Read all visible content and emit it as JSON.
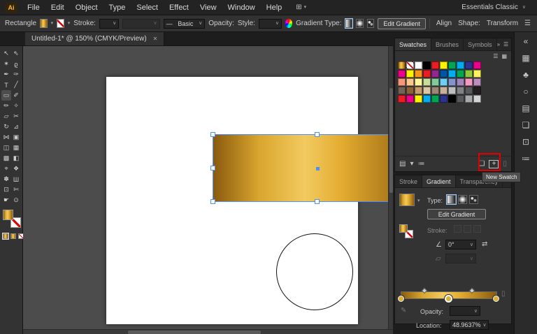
{
  "app": {
    "logo": "Ai"
  },
  "icons": {
    "caret": "∨",
    "caret_small": "▾",
    "menu": "☰",
    "close": "✕",
    "collapse_right": "»",
    "list_view": "☰",
    "grid_view": "▦",
    "arrange_docs": "⊞",
    "libraries": "▤",
    "kinds_filter": "▾",
    "options": "≔",
    "new_color_group": "❏",
    "plus": "+",
    "trash": "▯",
    "angle": "∠",
    "aspect": "▱",
    "reverse": "⇄",
    "edit_stop": "✎",
    "brush_stroke": "—",
    "hamburger": "☰"
  },
  "menubar": {
    "items": [
      "File",
      "Edit",
      "Object",
      "Type",
      "Select",
      "Effect",
      "View",
      "Window",
      "Help"
    ],
    "workspace": "Essentials Classic"
  },
  "controlbar": {
    "tool": "Rectangle",
    "stroke_label": "Stroke:",
    "brush_name": "Basic",
    "opacity_label": "Opacity:",
    "style_label": "Style:",
    "gradient_type_label": "Gradient Type:",
    "edit_gradient": "Edit Gradient",
    "align": "Align",
    "shape_label": "Shape:",
    "transform": "Transform"
  },
  "doc_tab": {
    "title": "Untitled-1* @ 150% (CMYK/Preview)"
  },
  "toolbar": {
    "active": "rectangle",
    "tools": [
      {
        "name": "selection",
        "glyph": "↖"
      },
      {
        "name": "direct-selection",
        "glyph": "⇖"
      },
      {
        "name": "magic-wand",
        "glyph": "✶"
      },
      {
        "name": "lasso",
        "glyph": "ϱ"
      },
      {
        "name": "pen",
        "glyph": "✒"
      },
      {
        "name": "curvature",
        "glyph": "✑"
      },
      {
        "name": "type",
        "glyph": "T"
      },
      {
        "name": "line-segment",
        "glyph": "╱"
      },
      {
        "name": "rectangle",
        "glyph": "▭"
      },
      {
        "name": "paintbrush",
        "glyph": "✐"
      },
      {
        "name": "pencil",
        "glyph": "✏"
      },
      {
        "name": "shaper",
        "glyph": "✧"
      },
      {
        "name": "eraser",
        "glyph": "▱"
      },
      {
        "name": "scissors",
        "glyph": "✂"
      },
      {
        "name": "rotate",
        "glyph": "↻"
      },
      {
        "name": "scale",
        "glyph": "⊿"
      },
      {
        "name": "width",
        "glyph": "⋈"
      },
      {
        "name": "free-transform",
        "glyph": "▣"
      },
      {
        "name": "shape-builder",
        "glyph": "◫"
      },
      {
        "name": "perspective-grid",
        "glyph": "▦"
      },
      {
        "name": "mesh",
        "glyph": "▩"
      },
      {
        "name": "gradient",
        "glyph": "◧"
      },
      {
        "name": "eyedropper",
        "glyph": "⌖"
      },
      {
        "name": "blend",
        "glyph": "❖"
      },
      {
        "name": "symbol-sprayer",
        "glyph": "✽"
      },
      {
        "name": "column-graph",
        "glyph": "Ш"
      },
      {
        "name": "artboard",
        "glyph": "⊡"
      },
      {
        "name": "slice",
        "glyph": "✄"
      },
      {
        "name": "hand",
        "glyph": "☛"
      },
      {
        "name": "zoom",
        "glyph": "⊙"
      }
    ]
  },
  "swatches_panel": {
    "tabs": [
      "Swatches",
      "Brushes",
      "Symbols"
    ],
    "active_tab": "Swatches",
    "tooltip": "New Swatch",
    "grid": [
      [
        "gradient",
        "none",
        "#ffffff",
        "#000000",
        "#ed1c24",
        "#fff200",
        "#00a651",
        "#00aeef",
        "#2e3192",
        "#ec008c"
      ],
      [
        "#ec008c",
        "#fff200",
        "#f7941d",
        "#ed1c24",
        "#92278f",
        "#0054a6",
        "#00aeef",
        "#00a651",
        "#8dc63f",
        "#fff45c"
      ],
      [
        "#f7977a",
        "#fdc68c",
        "#fff79a",
        "#c4df9b",
        "#82ca9c",
        "#6ccff6",
        "#8493ca",
        "#a186be",
        "#f49ac1",
        "#bc8dbf"
      ],
      [
        "#736357",
        "#8c6239",
        "#c69c6d",
        "#d9c6a5",
        "#998675",
        "#c7b299",
        "#bcbec0",
        "#808285",
        "#58595b",
        "#231f20"
      ],
      [
        "#ed1c24",
        "#ec008c",
        "#fff200",
        "#00aeef",
        "#00a651",
        "#2e3192",
        "#000000",
        "#58595b",
        "#a7a9ac",
        "#d1d3d4"
      ]
    ]
  },
  "gradient_panel": {
    "tabs": [
      "Stroke",
      "Gradient",
      "Transparency"
    ],
    "active_tab": "Gradient",
    "type_label": "Type:",
    "edit_gradient": "Edit Gradient",
    "stroke_label": "Stroke:",
    "angle_value": "0°",
    "opacity_label": "Opacity:",
    "opacity_value": "",
    "location_label": "Location:",
    "location_value": "48.9637%",
    "stops": [
      {
        "pos": 0
      },
      {
        "pos": 48.9637,
        "selected": true
      },
      {
        "pos": 100
      }
    ]
  },
  "dock": {
    "items": [
      {
        "name": "collapse-panels",
        "glyph": "«"
      },
      {
        "name": "color-panel",
        "glyph": "▦"
      },
      {
        "name": "symbols-panel",
        "glyph": "♣"
      },
      {
        "name": "color-guide-panel",
        "glyph": "○"
      },
      {
        "name": "libraries-panel",
        "glyph": "▤"
      },
      {
        "name": "layers-panel",
        "glyph": "❏"
      },
      {
        "name": "artboards-panel",
        "glyph": "⊡"
      },
      {
        "name": "properties-panel",
        "glyph": "≔"
      }
    ]
  },
  "colors": {
    "gold_gradient": [
      "#8a5a0e",
      "#d9a62e",
      "#f2ca60",
      "#e3ab2f",
      "#8a5a0e"
    ],
    "selection_blue": "#4a90ff",
    "highlight_red": "#e10000",
    "artboard": "#ffffff",
    "pasteboard": "#4c4c4c"
  }
}
